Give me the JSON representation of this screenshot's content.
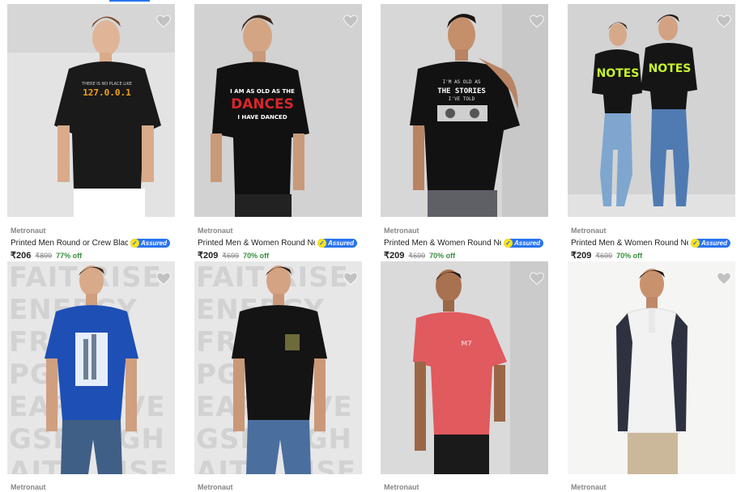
{
  "products": [
    {
      "brand": "Metronaut",
      "title": "Printed Men Round or Crew Black ...",
      "assured": "Assured",
      "price": "₹206",
      "mrp": "₹899",
      "off": "77% off",
      "shirt_color": "#1a1a1a",
      "tee_print": "THERE IS NO PLACE LIKE 127.0.0.1"
    },
    {
      "brand": "Metronaut",
      "title": "Printed Men & Women Round Nec...",
      "assured": "Assured",
      "price": "₹209",
      "mrp": "₹699",
      "off": "70% off",
      "shirt_color": "#111111",
      "tee_print": "I AM AS OLD AS THE DANCES I HAVE DANCED"
    },
    {
      "brand": "Metronaut",
      "title": "Printed Men & Women Round Nec...",
      "assured": "Assured",
      "price": "₹209",
      "mrp": "₹699",
      "off": "70% off",
      "shirt_color": "#121212",
      "tee_print": "I'M AS OLD AS THE STORIES I'VE TOLD"
    },
    {
      "brand": "Metronaut",
      "title": "Printed Men & Women Round Nec...",
      "assured": "Assured",
      "price": "₹209",
      "mrp": "₹699",
      "off": "70% off",
      "shirt_color": "#151515",
      "tee_print": "NOTES"
    },
    {
      "brand": "Metronaut",
      "shirt_color": "#1e4fb5",
      "bg_words": "FAITRISEENERGYFRISEPGOEARLOVEGSEHIGHAITHENERGYIRISE"
    },
    {
      "brand": "Metronaut",
      "shirt_color": "#141414",
      "bg_words": "FAITRISEENERGYFRISEPGOEARLOVEGSEHIGHAITHENERGYIRISE"
    },
    {
      "brand": "Metronaut",
      "shirt_color": "#e05a5e",
      "tee_print": "M7"
    },
    {
      "brand": "Metronaut",
      "shirt_color": "#f2f2f2",
      "sleeve_color": "#2e3140"
    }
  ],
  "colors": {
    "accent": "#2874f0",
    "offer_green": "#388e3c",
    "muted": "#878787"
  },
  "icons": {
    "wishlist": "heart-icon",
    "assured": "assured-badge-icon"
  }
}
